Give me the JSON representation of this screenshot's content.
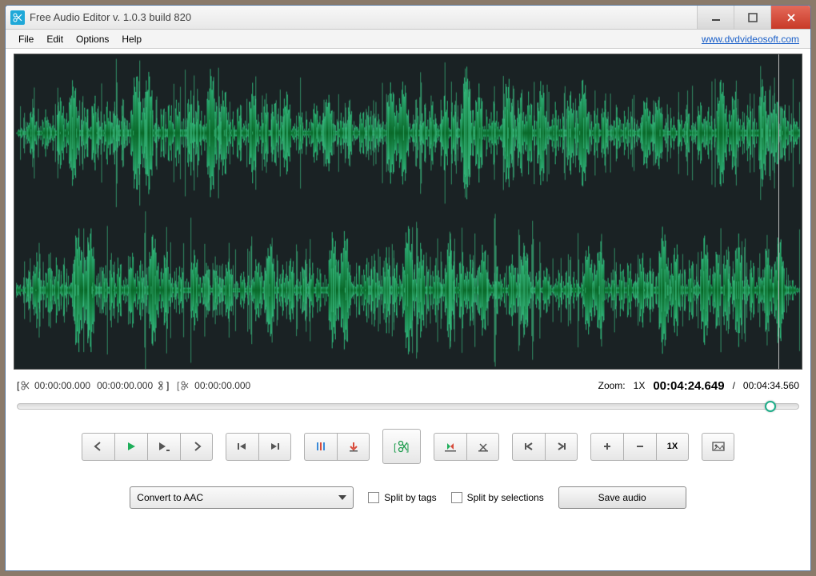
{
  "titlebar": {
    "title": "Free Audio Editor v. 1.0.3 build 820"
  },
  "menu": {
    "file": "File",
    "edit": "Edit",
    "options": "Options",
    "help": "Help",
    "link": "www.dvdvideosoft.com"
  },
  "selection": {
    "start": "00:00:00.000",
    "end": "00:00:00.000",
    "cut": "00:00:00.000"
  },
  "zoom": {
    "label": "Zoom:",
    "level": "1X"
  },
  "time": {
    "current": "00:04:24.649",
    "sep": "/",
    "total": "00:04:34.560"
  },
  "playback_progress_percent": 96.4,
  "zoom_level_label": "1X",
  "output": {
    "format": "Convert to AAC",
    "split_tags": "Split by tags",
    "split_selections": "Split by selections",
    "save": "Save audio"
  },
  "icons": {
    "app": "scissors",
    "winmin": "minimize",
    "winmax": "maximize",
    "winclose": "close"
  }
}
